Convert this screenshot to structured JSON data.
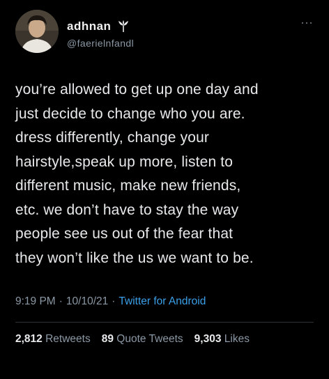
{
  "author": {
    "display_name": "adhnan",
    "handle": "@faerielnfandl",
    "badge_icon": "tulip-icon"
  },
  "tweet": {
    "lines": [
      "you’re allowed to get up one day and",
      "just decide to change who you are.",
      "dress differently, change your",
      "hairstyle,speak up more, listen to",
      "different music, make new friends,",
      "etc. we don’t have to stay the way",
      "people see us out of the fear that",
      "they won’t like the us we want to be."
    ]
  },
  "meta": {
    "time": "9:19 PM",
    "sep1": "·",
    "date": "10/10/21",
    "sep2": "·",
    "source": "Twitter for Android"
  },
  "stats": {
    "retweets_count": "2,812",
    "retweets_label": "Retweets",
    "quotes_count": "89",
    "quotes_label": "Quote Tweets",
    "likes_count": "9,303",
    "likes_label": "Likes"
  },
  "colors": {
    "background": "#000000",
    "text": "#e7e9ea",
    "secondary": "#8b98a5",
    "link": "#3aa0e8"
  },
  "icons": {
    "more": "more-icon",
    "badge": "tulip-icon"
  }
}
